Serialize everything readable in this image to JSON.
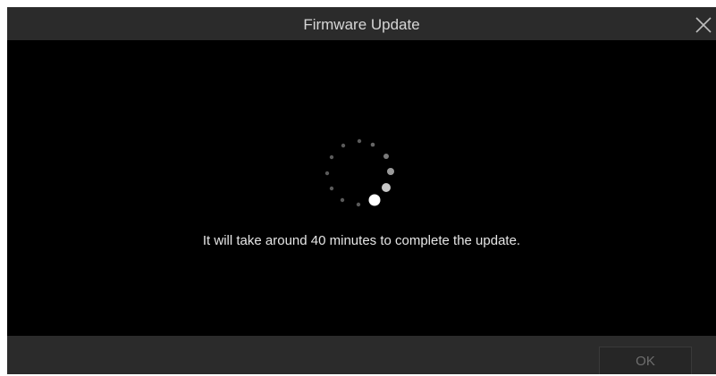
{
  "dialog": {
    "title": "Firmware Update",
    "message": "It will take around 40 minutes to complete the update.",
    "ok_label": "OK"
  },
  "icons": {
    "close": "close-icon",
    "spinner": "loading-spinner-icon"
  },
  "colors": {
    "titlebar": "#2b2b2b",
    "background": "#000000",
    "text": "#e6e6e6",
    "button_disabled_text": "#6e6e6e"
  },
  "status": {
    "ok_button_enabled": false
  }
}
